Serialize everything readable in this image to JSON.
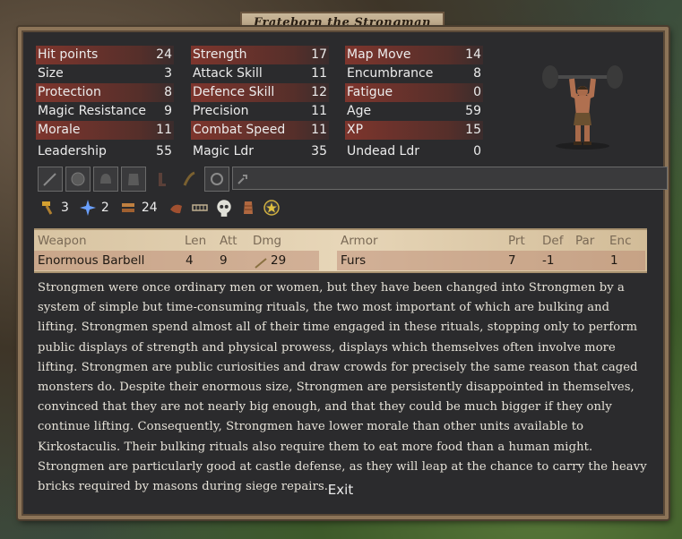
{
  "window_title": "Frateborn the Strongman",
  "stats": {
    "col1": [
      {
        "label": "Hit points",
        "value": "24",
        "highlight": true
      },
      {
        "label": "Size",
        "value": "3",
        "highlight": false
      },
      {
        "label": "Protection",
        "value": "8",
        "highlight": true
      },
      {
        "label": "Magic Resistance",
        "value": "9",
        "highlight": false
      },
      {
        "label": "Morale",
        "value": "11",
        "highlight": true
      },
      {
        "label": "Leadership",
        "value": "55",
        "highlight": false
      }
    ],
    "col2": [
      {
        "label": "Strength",
        "value": "17",
        "highlight": true
      },
      {
        "label": "Attack Skill",
        "value": "11",
        "highlight": false
      },
      {
        "label": "Defence Skill",
        "value": "12",
        "highlight": true
      },
      {
        "label": "Precision",
        "value": "11",
        "highlight": false
      },
      {
        "label": "Combat Speed",
        "value": "11",
        "highlight": true
      },
      {
        "label": "Magic Ldr",
        "value": "35",
        "highlight": false
      }
    ],
    "col3": [
      {
        "label": "Map Move",
        "value": "14",
        "highlight": true
      },
      {
        "label": "Encumbrance",
        "value": "8",
        "highlight": false
      },
      {
        "label": "Fatigue",
        "value": "0",
        "highlight": true
      },
      {
        "label": "Age",
        "value": "59",
        "highlight": false
      },
      {
        "label": "XP",
        "value": "15",
        "highlight": true
      },
      {
        "label": "Undead Ldr",
        "value": "0",
        "highlight": false
      }
    ]
  },
  "equipment_slots": [
    "sword-slot-icon",
    "shield-slot-icon",
    "helmet-slot-icon",
    "armor-slot-icon",
    "boots-slot-icon",
    "misc-slot-icon",
    "ring-slot-icon",
    "misc-item-slot-icon"
  ],
  "abilities": {
    "hammer_count": "3",
    "magic_count": "2",
    "resource_count": "24"
  },
  "weapon_table": {
    "headers": {
      "weapon": "Weapon",
      "len": "Len",
      "att": "Att",
      "dmg": "Dmg",
      "armor": "Armor",
      "prt": "Prt",
      "def": "Def",
      "par": "Par",
      "enc": "Enc"
    },
    "row": {
      "weapon": "Enormous Barbell",
      "len": "4",
      "att": "9",
      "dmg": "29",
      "armor": "Furs",
      "prt": "7",
      "def": "-1",
      "par": "",
      "enc": "1"
    }
  },
  "description": "Strongmen were once ordinary men or women, but they have been changed into Strongmen by a system of simple but time-consuming rituals, the two most important of which are bulking and lifting. Strongmen spend almost all of their time engaged in these rituals, stopping only to perform public displays of strength and physical prowess, displays which themselves often involve more lifting. Strongmen are public curiosities and draw crowds for precisely the same reason that caged monsters do. Despite their enormous size, Strongmen are persistently disappointed in themselves, convinced that they are not nearly big enough, and that they could be much bigger if they only continue lifting. Consequently, Strongmen have lower morale than other units available to Kirkostaculis. Their bulking rituals also require them to eat more food than a human might. Strongmen are particularly good at castle defense, as they will leap at the chance to carry the heavy bricks required by masons during siege repairs.",
  "exit_label": "Exit",
  "colors": {
    "frame_border": "#8c7458",
    "panel_bg": "#2b2b2d",
    "stat_highlight": "#8c372d",
    "parchment": "#e7d6b8"
  }
}
